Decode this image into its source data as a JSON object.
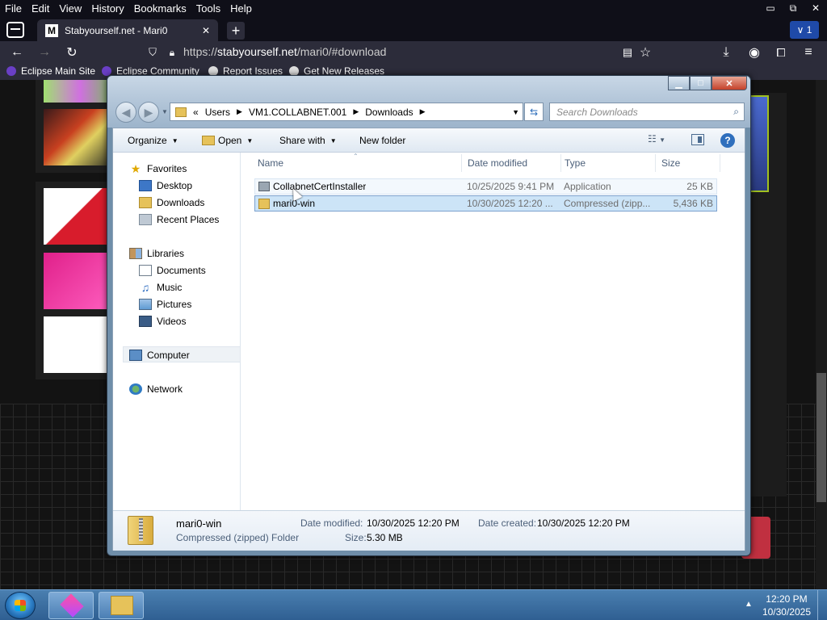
{
  "browser": {
    "menus": [
      "File",
      "Edit",
      "View",
      "History",
      "Bookmarks",
      "Tools",
      "Help"
    ],
    "tab_title": "Stabyourself.net - Mari0",
    "tab_favicon": "M",
    "tab_close": "✕",
    "new_tab": "+",
    "tab_list_label": "∨ 1",
    "url_prefix": "https://",
    "url_host": "stabyourself.net",
    "url_path": "/mari0/#download",
    "bookmarks": [
      "Eclipse Main Site",
      "Eclipse Community",
      "Report Issues",
      "Get New Releases"
    ],
    "win_minimize": "▭",
    "win_restore": "⧉",
    "win_close": "✕",
    "accent_color": "#1f4aa8"
  },
  "explorer": {
    "breadcrumb": {
      "prefix": "«",
      "segments": [
        "Users",
        "VM1.COLLABNET.001",
        "Downloads"
      ]
    },
    "search_placeholder": "Search Downloads",
    "toolbar": {
      "organize": "Organize",
      "open": "Open",
      "share_with": "Share with",
      "new_folder": "New folder",
      "help": "?"
    },
    "nav": {
      "favorites": "Favorites",
      "desktop": "Desktop",
      "downloads": "Downloads",
      "recent_places": "Recent Places",
      "libraries": "Libraries",
      "documents": "Documents",
      "music": "Music",
      "pictures": "Pictures",
      "videos": "Videos",
      "computer": "Computer",
      "network": "Network"
    },
    "columns": {
      "name": "Name",
      "date_modified": "Date modified",
      "type": "Type",
      "size": "Size"
    },
    "files": [
      {
        "name": "CollabnetCertInstaller",
        "date": "10/25/2025 9:41 PM",
        "type": "Application",
        "size": "25 KB",
        "icon": "application-icon"
      },
      {
        "name": "mari0-win",
        "date": "10/30/2025 12:20 ...",
        "type": "Compressed (zipp...",
        "size": "5,436 KB",
        "icon": "zip-folder-icon"
      }
    ],
    "details": {
      "name": "mari0-win",
      "kind": "Compressed (zipped) Folder",
      "date_modified_label": "Date modified:",
      "date_modified": "10/30/2025 12:20 PM",
      "date_created_label": "Date created:",
      "date_created": "10/30/2025 12:20 PM",
      "size_label": "Size:",
      "size": "5.30 MB"
    }
  },
  "taskbar": {
    "time": "12:20 PM",
    "date": "10/30/2025",
    "tray_arrow": "▲"
  }
}
